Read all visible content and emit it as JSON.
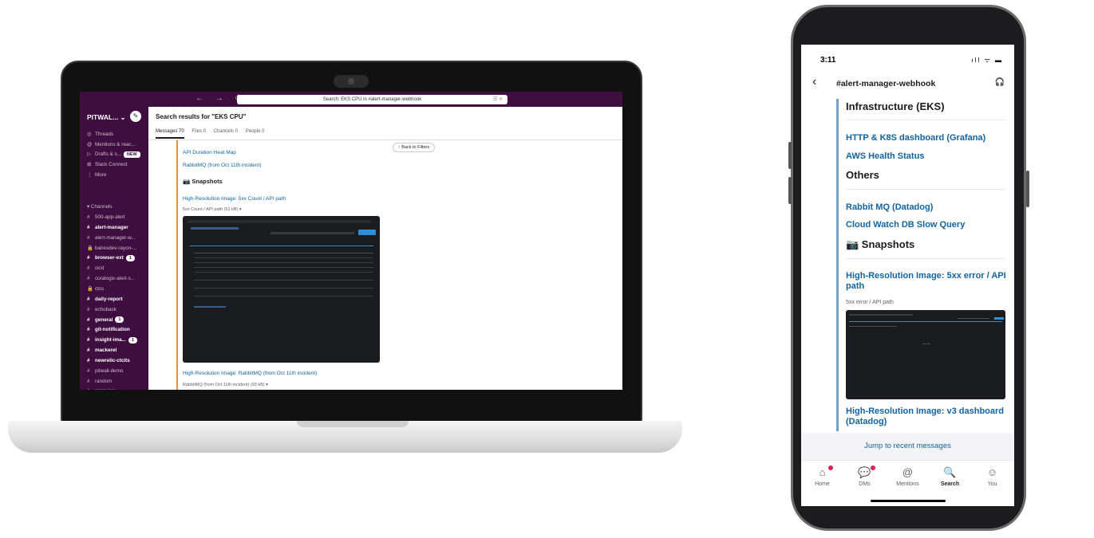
{
  "laptop": {
    "topbar": {
      "nav": "← → ⏱",
      "search": "Search: EKS CPU in #alert-manager-webhook",
      "search_controls": "☰ ✕"
    },
    "sidebar": {
      "workspace": "PITWAL... ⌄",
      "compose_icon": "✎",
      "nav_items": [
        {
          "icon": "◎",
          "label": "Threads"
        },
        {
          "icon": "@",
          "label": "Mentions & reac..."
        },
        {
          "icon": "▷",
          "label": "Drafts & s...",
          "badge": "NEW"
        },
        {
          "icon": "⊞",
          "label": "Slack Connect"
        },
        {
          "icon": "⋮",
          "label": "More"
        }
      ],
      "channels_header": "▾  Channels",
      "channels": [
        {
          "icon": "#",
          "label": "500-app-alert",
          "bold": false
        },
        {
          "icon": "#",
          "label": "alert-manager",
          "bold": true
        },
        {
          "icon": "#",
          "label": "alert-manager-w...",
          "bold": false
        },
        {
          "icon": "🔒",
          "label": "bairesdev-rayon-...",
          "bold": false
        },
        {
          "icon": "#",
          "label": "browser-ext",
          "bold": true,
          "badge": "1"
        },
        {
          "icon": "#",
          "label": "cicd",
          "bold": false
        },
        {
          "icon": "#",
          "label": "coralogix-alert-s...",
          "bold": false
        },
        {
          "icon": "🔒",
          "label": "ctcs",
          "bold": false
        },
        {
          "icon": "#",
          "label": "daily-report",
          "bold": true
        },
        {
          "icon": "#",
          "label": "echoback",
          "bold": false
        },
        {
          "icon": "#",
          "label": "general",
          "bold": true,
          "badge": "1"
        },
        {
          "icon": "#",
          "label": "git-notification",
          "bold": true
        },
        {
          "icon": "#",
          "label": "insight-ima...",
          "bold": true,
          "badge": "1"
        },
        {
          "icon": "#",
          "label": "mackerel",
          "bold": true
        },
        {
          "icon": "#",
          "label": "newrelic-ctcits",
          "bold": true
        },
        {
          "icon": "#",
          "label": "pitwall-demo",
          "bold": false
        },
        {
          "icon": "#",
          "label": "random",
          "bold": false
        },
        {
          "icon": "#",
          "label": "snapview",
          "bold": false
        }
      ]
    },
    "main": {
      "title": "Search results for \"EKS CPU\"",
      "tabs": [
        "Messages 70",
        "Files 0",
        "Channels 0",
        "People 0"
      ],
      "back_button": "↑ Back to Filters",
      "links": {
        "api_heatmap": "API Duration Heat Map",
        "rabbitmq": "RabbitMQ (from Oct 11th incident)"
      },
      "snapshots_header": "📷 Snapshots",
      "image1_title": "High-Resolution Image: 5xx Count / API path",
      "image1_caption": "5xx Count / API path (51 kB) ▾",
      "image2_title": "High-Resolution Image: RabbitMQ (from Oct 11th incident)",
      "image2_caption": "RabbitMQ (from Oct 11th incident) (93 kB) ▾"
    }
  },
  "phone": {
    "status": {
      "time": "3:11",
      "icons": "ıll ᯤ ▬"
    },
    "header": {
      "back": "‹",
      "channel": "#alert-manager-webhook",
      "headphones": "🎧"
    },
    "content": {
      "infra_header": "Infrastructure (EKS)",
      "link_grafana": "HTTP & K8S dashboard (Grafana)",
      "link_aws": "AWS Health Status",
      "others_header": "Others",
      "link_rabbit": "Rabbit MQ (Datadog)",
      "link_cloudwatch": "Cloud Watch DB Slow Query",
      "snapshots_header": "📷 Snapshots",
      "image1_title": "High-Resolution Image: 5xx error / API path",
      "image1_caption": "5xx error / API path",
      "image2_title": "High-Resolution Image: v3 dashboard (Datadog)"
    },
    "jump": "Jump to recent messages",
    "tabbar": [
      {
        "icon": "⌂",
        "label": "Home",
        "dot": true,
        "active": false
      },
      {
        "icon": "💬",
        "label": "DMs",
        "dot": true,
        "active": false
      },
      {
        "icon": "@",
        "label": "Mentions",
        "dot": false,
        "active": false
      },
      {
        "icon": "🔍",
        "label": "Search",
        "dot": false,
        "active": true
      },
      {
        "icon": "☺",
        "label": "You",
        "dot": false,
        "active": false
      }
    ]
  }
}
